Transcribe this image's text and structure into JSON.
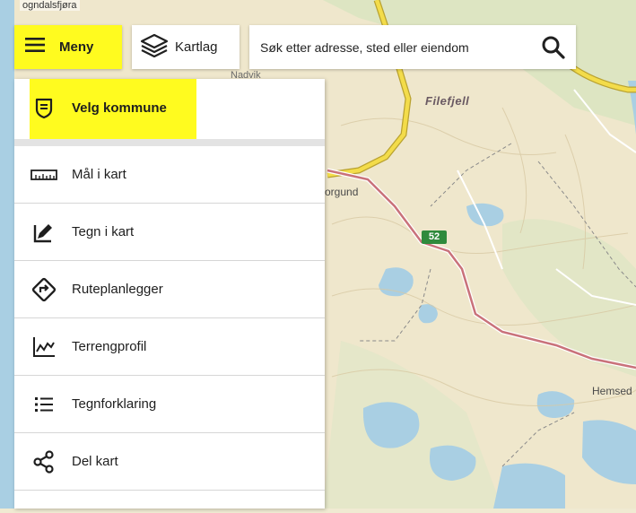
{
  "map": {
    "labels": {
      "top_left": "ogndalsfjøra",
      "nadvik": "Nadvik",
      "filefjell": "Filefjell",
      "borgund": "orgund",
      "hemsedal": "Hemsed"
    },
    "road_number": "52",
    "colors": {
      "land": "#f0ead2",
      "water": "#a9cfe3",
      "forest": "#cfe2b9",
      "main_road": "#e6cf3e",
      "secondary_road": "#c66b72"
    }
  },
  "topbar": {
    "menu_label": "Meny",
    "layers_label": "Kartlag",
    "search_placeholder": "Søk etter adresse, sted eller eiendom"
  },
  "menu": {
    "header_item": "Velg kommune",
    "items": [
      {
        "label": "Mål i kart",
        "icon": "ruler-icon"
      },
      {
        "label": "Tegn i kart",
        "icon": "draw-icon"
      },
      {
        "label": "Ruteplanlegger",
        "icon": "route-icon"
      },
      {
        "label": "Terrengprofil",
        "icon": "terrain-profile-icon"
      },
      {
        "label": "Tegnforklaring",
        "icon": "legend-list-icon"
      },
      {
        "label": "Del kart",
        "icon": "share-icon"
      }
    ]
  },
  "colors": {
    "highlight": "#fffb1f"
  }
}
